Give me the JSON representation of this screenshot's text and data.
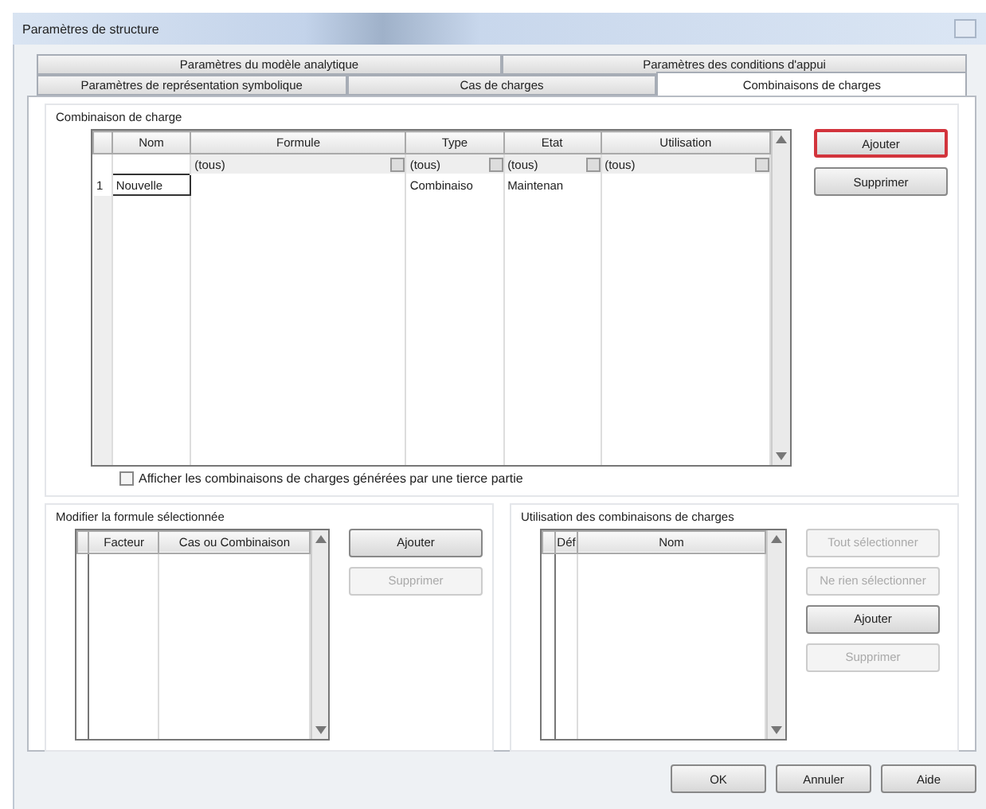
{
  "window": {
    "title": "Paramètres de structure"
  },
  "tab_rows": [
    [
      {
        "label": "Paramètres du modèle analytique",
        "selected": false
      },
      {
        "label": "Paramètres des conditions d'appui",
        "selected": false
      }
    ],
    [
      {
        "label": "Paramètres de représentation symbolique",
        "selected": false
      },
      {
        "label": "Cas de charges",
        "selected": false
      },
      {
        "label": "Combinaisons de charges",
        "selected": true
      }
    ]
  ],
  "combinations": {
    "title": "Combinaison de charge",
    "columns": [
      "Nom",
      "Formule",
      "Type",
      "Etat",
      "Utilisation"
    ],
    "filters": [
      "(tous)",
      "(tous)",
      "(tous)",
      "(tous)"
    ],
    "rows": [
      {
        "number": "1",
        "cells": [
          "Nouvelle",
          "",
          "Combinaiso",
          "Maintenan",
          ""
        ]
      }
    ],
    "buttons": [
      {
        "label": "Ajouter",
        "disabled": false,
        "focused": true
      },
      {
        "label": "Supprimer",
        "disabled": false,
        "focused": false
      }
    ]
  },
  "third_party": {
    "label": "Afficher les combinaisons de charges générées par une tierce partie",
    "checked": false
  },
  "formula": {
    "title": "Modifier la formule sélectionnée",
    "columns": [
      "Facteur",
      "Cas ou Combinaison"
    ],
    "buttons": [
      {
        "label": "Ajouter",
        "disabled": false
      },
      {
        "label": "Supprimer",
        "disabled": true
      }
    ]
  },
  "usage": {
    "title": "Utilisation des combinaisons de charges",
    "columns": [
      "Déf",
      "Nom"
    ],
    "buttons": [
      {
        "label": "Tout sélectionner",
        "disabled": true
      },
      {
        "label": "Ne rien sélectionner",
        "disabled": true
      },
      {
        "label": "Ajouter",
        "disabled": false
      },
      {
        "label": "Supprimer",
        "disabled": true
      }
    ]
  },
  "footer_buttons": [
    "OK",
    "Annuler",
    "Aide"
  ]
}
